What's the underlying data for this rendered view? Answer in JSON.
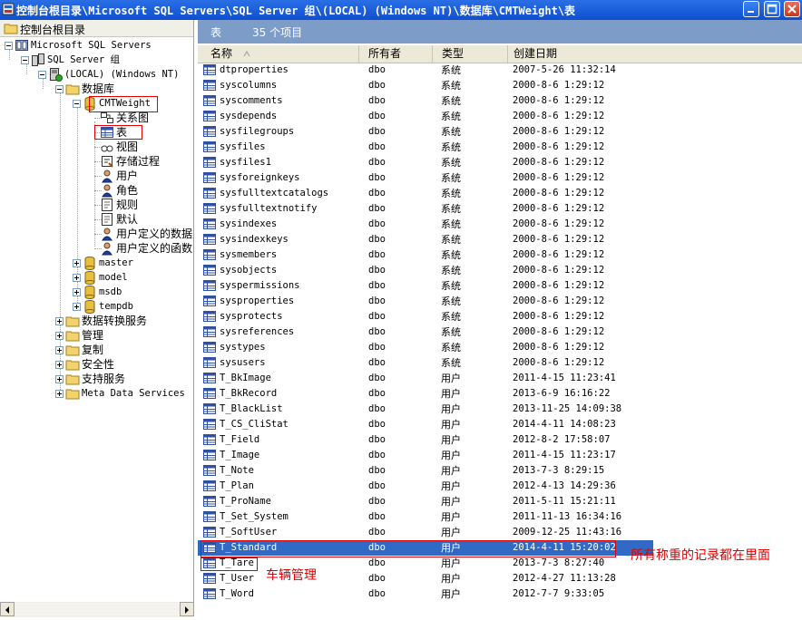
{
  "window": {
    "title": "控制台根目录\\Microsoft SQL Servers\\SQL Server 组\\(LOCAL) (Windows NT)\\数据库\\CMTWeight\\表"
  },
  "tree": {
    "header": "控制台根目录",
    "nodes": [
      {
        "label": "Microsoft SQL Servers",
        "icon": "sql-servers-icon"
      },
      {
        "label": "SQL Server 组",
        "icon": "server-group-icon"
      },
      {
        "label": "(LOCAL) (Windows NT)",
        "icon": "server-icon"
      },
      {
        "label": "数据库",
        "icon": "folder-icon"
      },
      {
        "label": "CMTWeight",
        "icon": "database-icon"
      },
      {
        "label": "关系图",
        "icon": "diagram-icon"
      },
      {
        "label": "表",
        "icon": "table-icon"
      },
      {
        "label": "视图",
        "icon": "view-icon"
      },
      {
        "label": "存储过程",
        "icon": "stored-procedure-icon"
      },
      {
        "label": "用户",
        "icon": "user-icon"
      },
      {
        "label": "角色",
        "icon": "role-icon"
      },
      {
        "label": "规则",
        "icon": "rule-icon"
      },
      {
        "label": "默认",
        "icon": "default-icon"
      },
      {
        "label": "用户定义的数据类型",
        "icon": "udt-icon"
      },
      {
        "label": "用户定义的函数",
        "icon": "udf-icon"
      },
      {
        "label": "master",
        "icon": "database-icon"
      },
      {
        "label": "model",
        "icon": "database-icon"
      },
      {
        "label": "msdb",
        "icon": "database-icon"
      },
      {
        "label": "tempdb",
        "icon": "database-icon"
      },
      {
        "label": "数据转换服务",
        "icon": "folder-icon"
      },
      {
        "label": "管理",
        "icon": "folder-icon"
      },
      {
        "label": "复制",
        "icon": "folder-icon"
      },
      {
        "label": "安全性",
        "icon": "folder-icon"
      },
      {
        "label": "支持服务",
        "icon": "folder-icon"
      },
      {
        "label": "Meta Data Services",
        "icon": "folder-icon"
      }
    ]
  },
  "list": {
    "title": "表",
    "count": "35 个项目",
    "columns": [
      "名称",
      "所有者",
      "类型",
      "创建日期"
    ],
    "rows": [
      {
        "name": "dtproperties",
        "owner": "dbo",
        "type": "系统",
        "date": "2007-5-26 11:32:14"
      },
      {
        "name": "syscolumns",
        "owner": "dbo",
        "type": "系统",
        "date": "2000-8-6 1:29:12"
      },
      {
        "name": "syscomments",
        "owner": "dbo",
        "type": "系统",
        "date": "2000-8-6 1:29:12"
      },
      {
        "name": "sysdepends",
        "owner": "dbo",
        "type": "系统",
        "date": "2000-8-6 1:29:12"
      },
      {
        "name": "sysfilegroups",
        "owner": "dbo",
        "type": "系统",
        "date": "2000-8-6 1:29:12"
      },
      {
        "name": "sysfiles",
        "owner": "dbo",
        "type": "系统",
        "date": "2000-8-6 1:29:12"
      },
      {
        "name": "sysfiles1",
        "owner": "dbo",
        "type": "系统",
        "date": "2000-8-6 1:29:12"
      },
      {
        "name": "sysforeignkeys",
        "owner": "dbo",
        "type": "系统",
        "date": "2000-8-6 1:29:12"
      },
      {
        "name": "sysfulltextcatalogs",
        "owner": "dbo",
        "type": "系统",
        "date": "2000-8-6 1:29:12"
      },
      {
        "name": "sysfulltextnotify",
        "owner": "dbo",
        "type": "系统",
        "date": "2000-8-6 1:29:12"
      },
      {
        "name": "sysindexes",
        "owner": "dbo",
        "type": "系统",
        "date": "2000-8-6 1:29:12"
      },
      {
        "name": "sysindexkeys",
        "owner": "dbo",
        "type": "系统",
        "date": "2000-8-6 1:29:12"
      },
      {
        "name": "sysmembers",
        "owner": "dbo",
        "type": "系统",
        "date": "2000-8-6 1:29:12"
      },
      {
        "name": "sysobjects",
        "owner": "dbo",
        "type": "系统",
        "date": "2000-8-6 1:29:12"
      },
      {
        "name": "syspermissions",
        "owner": "dbo",
        "type": "系统",
        "date": "2000-8-6 1:29:12"
      },
      {
        "name": "sysproperties",
        "owner": "dbo",
        "type": "系统",
        "date": "2000-8-6 1:29:12"
      },
      {
        "name": "sysprotects",
        "owner": "dbo",
        "type": "系统",
        "date": "2000-8-6 1:29:12"
      },
      {
        "name": "sysreferences",
        "owner": "dbo",
        "type": "系统",
        "date": "2000-8-6 1:29:12"
      },
      {
        "name": "systypes",
        "owner": "dbo",
        "type": "系统",
        "date": "2000-8-6 1:29:12"
      },
      {
        "name": "sysusers",
        "owner": "dbo",
        "type": "系统",
        "date": "2000-8-6 1:29:12"
      },
      {
        "name": "T_BkImage",
        "owner": "dbo",
        "type": "用户",
        "date": "2011-4-15 11:23:41"
      },
      {
        "name": "T_BkRecord",
        "owner": "dbo",
        "type": "用户",
        "date": "2013-6-9 16:16:22"
      },
      {
        "name": "T_BlackList",
        "owner": "dbo",
        "type": "用户",
        "date": "2013-11-25 14:09:38"
      },
      {
        "name": "T_CS_CliStat",
        "owner": "dbo",
        "type": "用户",
        "date": "2014-4-11 14:08:23"
      },
      {
        "name": "T_Field",
        "owner": "dbo",
        "type": "用户",
        "date": "2012-8-2 17:58:07"
      },
      {
        "name": "T_Image",
        "owner": "dbo",
        "type": "用户",
        "date": "2011-4-15 11:23:17"
      },
      {
        "name": "T_Note",
        "owner": "dbo",
        "type": "用户",
        "date": "2013-7-3 8:29:15"
      },
      {
        "name": "T_Plan",
        "owner": "dbo",
        "type": "用户",
        "date": "2012-4-13 14:29:36"
      },
      {
        "name": "T_ProName",
        "owner": "dbo",
        "type": "用户",
        "date": "2011-5-11 15:21:11"
      },
      {
        "name": "T_Set_System",
        "owner": "dbo",
        "type": "用户",
        "date": "2011-11-13 16:34:16"
      },
      {
        "name": "T_SoftUser",
        "owner": "dbo",
        "type": "用户",
        "date": "2009-12-25 11:43:16"
      },
      {
        "name": "T_Standard",
        "owner": "dbo",
        "type": "用户",
        "date": "2014-4-11 15:20:02"
      },
      {
        "name": "T_Tare",
        "owner": "dbo",
        "type": "用户",
        "date": "2013-7-3 8:27:40"
      },
      {
        "name": "T_User",
        "owner": "dbo",
        "type": "用户",
        "date": "2012-4-27 11:13:28"
      },
      {
        "name": "T_Word",
        "owner": "dbo",
        "type": "用户",
        "date": "2012-7-7 9:33:05"
      }
    ],
    "selected_row": "T_Standard"
  },
  "annotations": {
    "standard_note": "所有称重的记录都在里面",
    "tare_note": "车辆管理"
  },
  "colors": {
    "title_bar": "#1957d6",
    "selection": "#316ac5",
    "annotation_red": "#e00000",
    "list_header": "#7d9dc8"
  }
}
